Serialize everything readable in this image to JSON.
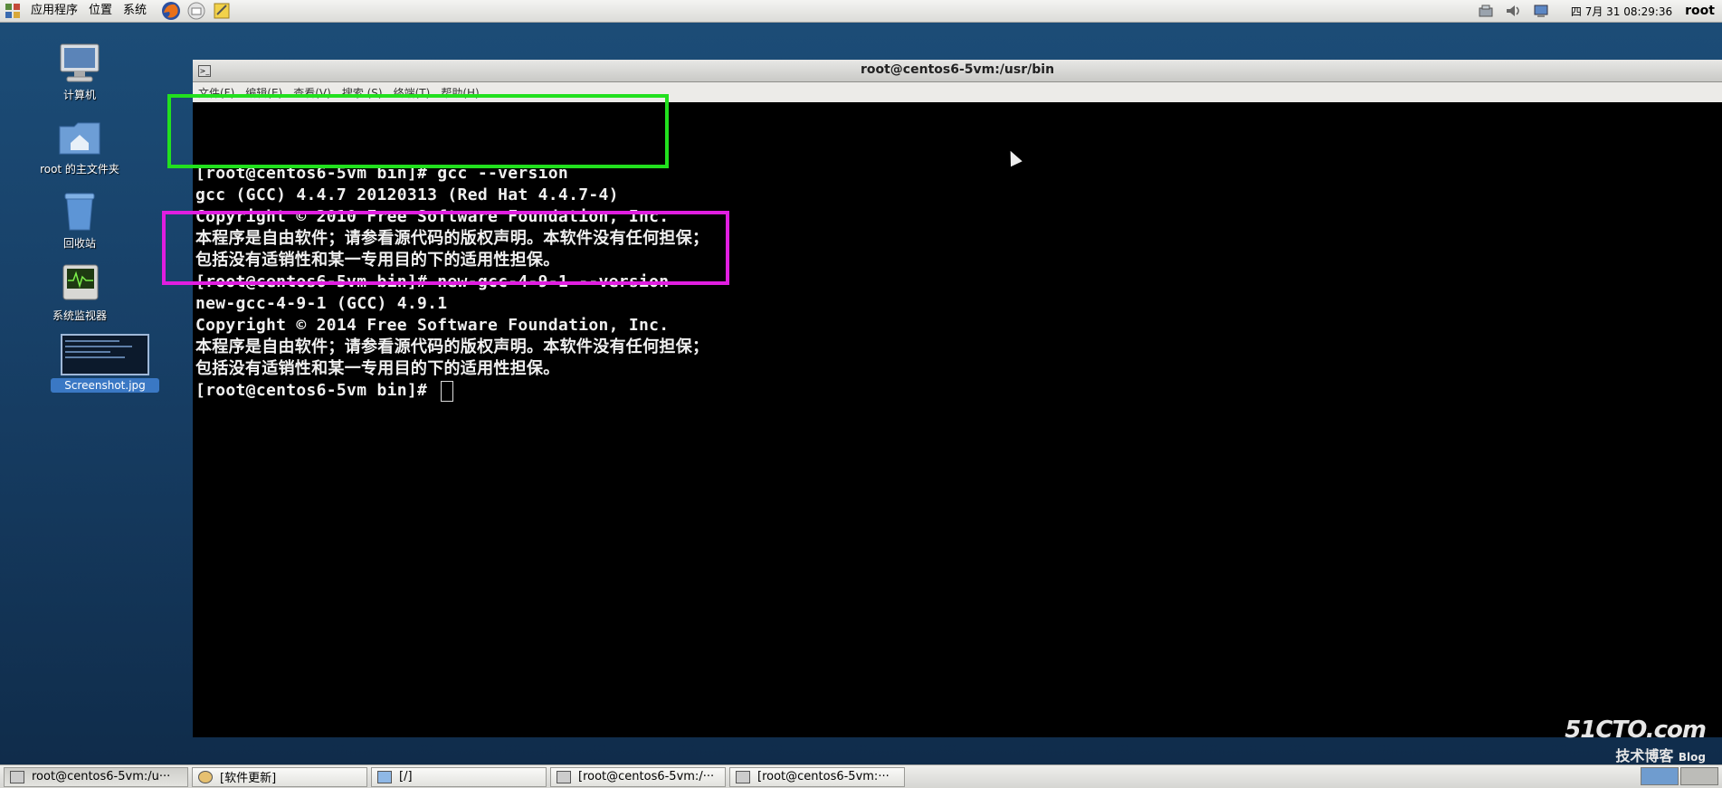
{
  "top_panel": {
    "menus": [
      "应用程序",
      "位置",
      "系统"
    ],
    "clock": "四 7月 31 08:29:36",
    "user": "root"
  },
  "desktop": {
    "icons": [
      {
        "label": "计算机",
        "icon": "computer-icon"
      },
      {
        "label": "root 的主文件夹",
        "icon": "home-folder-icon"
      },
      {
        "label": "回收站",
        "icon": "trash-icon"
      },
      {
        "label": "系统监视器",
        "icon": "system-monitor-icon"
      },
      {
        "label": "Screenshot.jpg",
        "icon": "image-file-icon"
      }
    ]
  },
  "window": {
    "title": "root@centos6-5vm:/usr/bin",
    "menus": [
      "文件(F)",
      "编辑(E)",
      "查看(V)",
      "搜索 (S)",
      "终端(T)",
      "帮助(H)"
    ]
  },
  "terminal": {
    "lines": [
      "[root@centos6-5vm bin]# gcc --version",
      "gcc (GCC) 4.4.7 20120313 (Red Hat 4.4.7-4)",
      "Copyright © 2010 Free Software Foundation, Inc.",
      "本程序是自由软件；请参看源代码的版权声明。本软件没有任何担保；",
      "包括没有适销性和某一专用目的下的适用性担保。",
      "[root@centos6-5vm bin]# new-gcc-4-9-1 --version",
      "new-gcc-4-9-1 (GCC) 4.9.1",
      "Copyright © 2014 Free Software Foundation, Inc.",
      "本程序是自由软件；请参看源代码的版权声明。本软件没有任何担保；",
      "包括没有适销性和某一专用目的下的适用性担保。",
      "[root@centos6-5vm bin]# "
    ],
    "highlight_colors": {
      "first": "#22e01e",
      "second": "#e01ee0"
    }
  },
  "watermark": {
    "site": "51CTO.com",
    "sub": "技术博客",
    "tag": "Blog"
  },
  "taskbar": {
    "items": [
      "root@centos6-5vm:/u···",
      "[软件更新]",
      "[/]",
      "[root@centos6-5vm:/···",
      "[root@centos6-5vm:···"
    ]
  }
}
